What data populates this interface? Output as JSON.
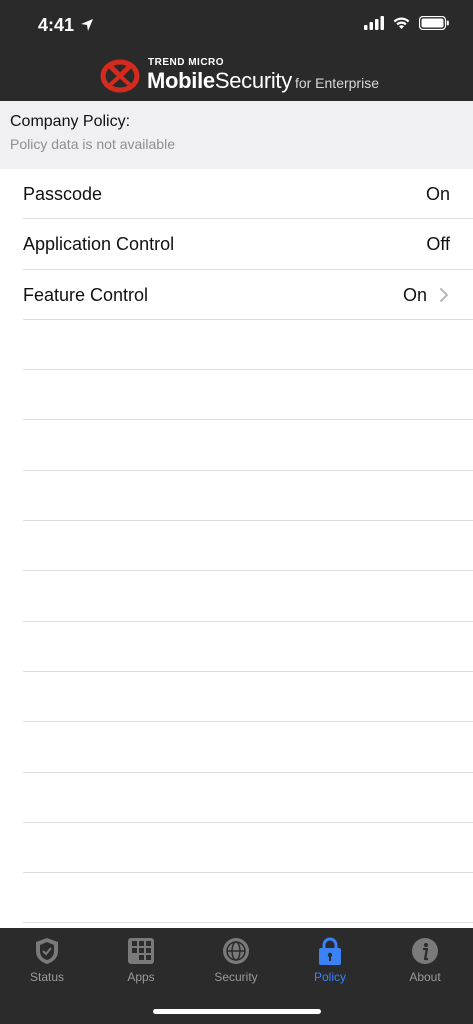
{
  "status_bar": {
    "time": "4:41"
  },
  "brand": {
    "small": "TREND MICRO",
    "mobile": "Mobile",
    "security": "Security",
    "enterprise": "for Enterprise"
  },
  "policy": {
    "title": "Company Policy:",
    "subtitle": "Policy data is not available"
  },
  "rows": [
    {
      "label": "Passcode",
      "value": "On"
    },
    {
      "label": "Application Control",
      "value": "Off"
    },
    {
      "label": "Feature Control",
      "value": "On"
    }
  ],
  "tabs": [
    {
      "label": "Status",
      "icon": "shield-icon"
    },
    {
      "label": "Apps",
      "icon": "apps-grid-icon"
    },
    {
      "label": "Security",
      "icon": "globe-icon"
    },
    {
      "label": "Policy",
      "icon": "lock-icon"
    },
    {
      "label": "About",
      "icon": "info-icon"
    }
  ],
  "colors": {
    "header_bg": "#2a2a2a",
    "band_bg": "#efeff4",
    "active_tab": "#3b82f6",
    "brand_red": "#d52b1e"
  }
}
